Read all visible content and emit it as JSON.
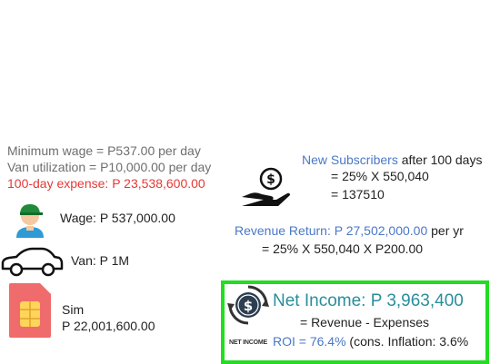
{
  "expenses": {
    "min_wage_text": "Minimum wage = P537.00 per day",
    "van_util_text": "Van utilization = P10,000.00 per day",
    "expense_text": "100-day expense:  P 23,538,600.00"
  },
  "items": {
    "wage_text": "Wage: P 537,000.00",
    "van_text": "Van: P 1M",
    "sim_label": "Sim",
    "sim_value": "P 22,001,600.00"
  },
  "subscribers": {
    "title": "New Subscribers",
    "suffix": " after 100 days",
    "eq1": "= 25% X 550,040",
    "eq2": "= 137510"
  },
  "revenue": {
    "label": "Revenue Return: P 27,502,000.00",
    "suffix": " per yr",
    "eq": "= 25% X 550,040 X P200.00"
  },
  "net_income": {
    "title": "Net Income: P 3,963,400",
    "eq": "= Revenue - Expenses",
    "icon_caption": "NET INCOME",
    "roi": "ROI = 76.4%",
    "roi_suffix": " (cons. Inflation: 3.6%"
  },
  "colors": {
    "accent_red": "#e53935",
    "accent_blue": "#4a78c8",
    "accent_teal": "#2a8f9a",
    "box_border": "#22dd22"
  }
}
